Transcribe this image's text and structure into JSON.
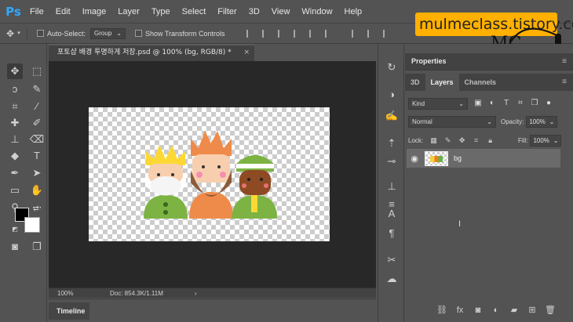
{
  "app": {
    "logo": "Ps"
  },
  "menu": [
    "File",
    "Edit",
    "Image",
    "Layer",
    "Type",
    "Select",
    "Filter",
    "3D",
    "View",
    "Window",
    "Help"
  ],
  "options": {
    "move_icon": "move-icon",
    "auto_select_label": "Auto-Select:",
    "auto_select_value": "Group",
    "show_transform_label": "Show Transform Controls"
  },
  "watermark": {
    "text": "mulmeclass.tistory.com",
    "logo": "MC"
  },
  "document": {
    "tab_title": "포토샵 배경 투명하게 저장.psd @ 100% (bg, RGB/8) *",
    "close": "×",
    "zoom": "100%",
    "doc_size": "Doc: 854.3K/1.11M"
  },
  "timeline": {
    "label": "Timeline"
  },
  "properties": {
    "label": "Properties"
  },
  "layers_panel": {
    "tabs": [
      "3D",
      "Layers",
      "Channels"
    ],
    "active_tab": "Layers",
    "kind_label": "Kind",
    "blend_mode": "Normal",
    "opacity_label": "Opacity:",
    "opacity_value": "100%",
    "lock_label": "Lock:",
    "fill_label": "Fill:",
    "fill_value": "100%",
    "layers": [
      {
        "name": "bg",
        "visible": true
      }
    ]
  },
  "colors": {
    "accent": "#31a8ff",
    "watermark_bg": "#ffb000",
    "foreground": "#000000",
    "background": "#ffffff"
  }
}
